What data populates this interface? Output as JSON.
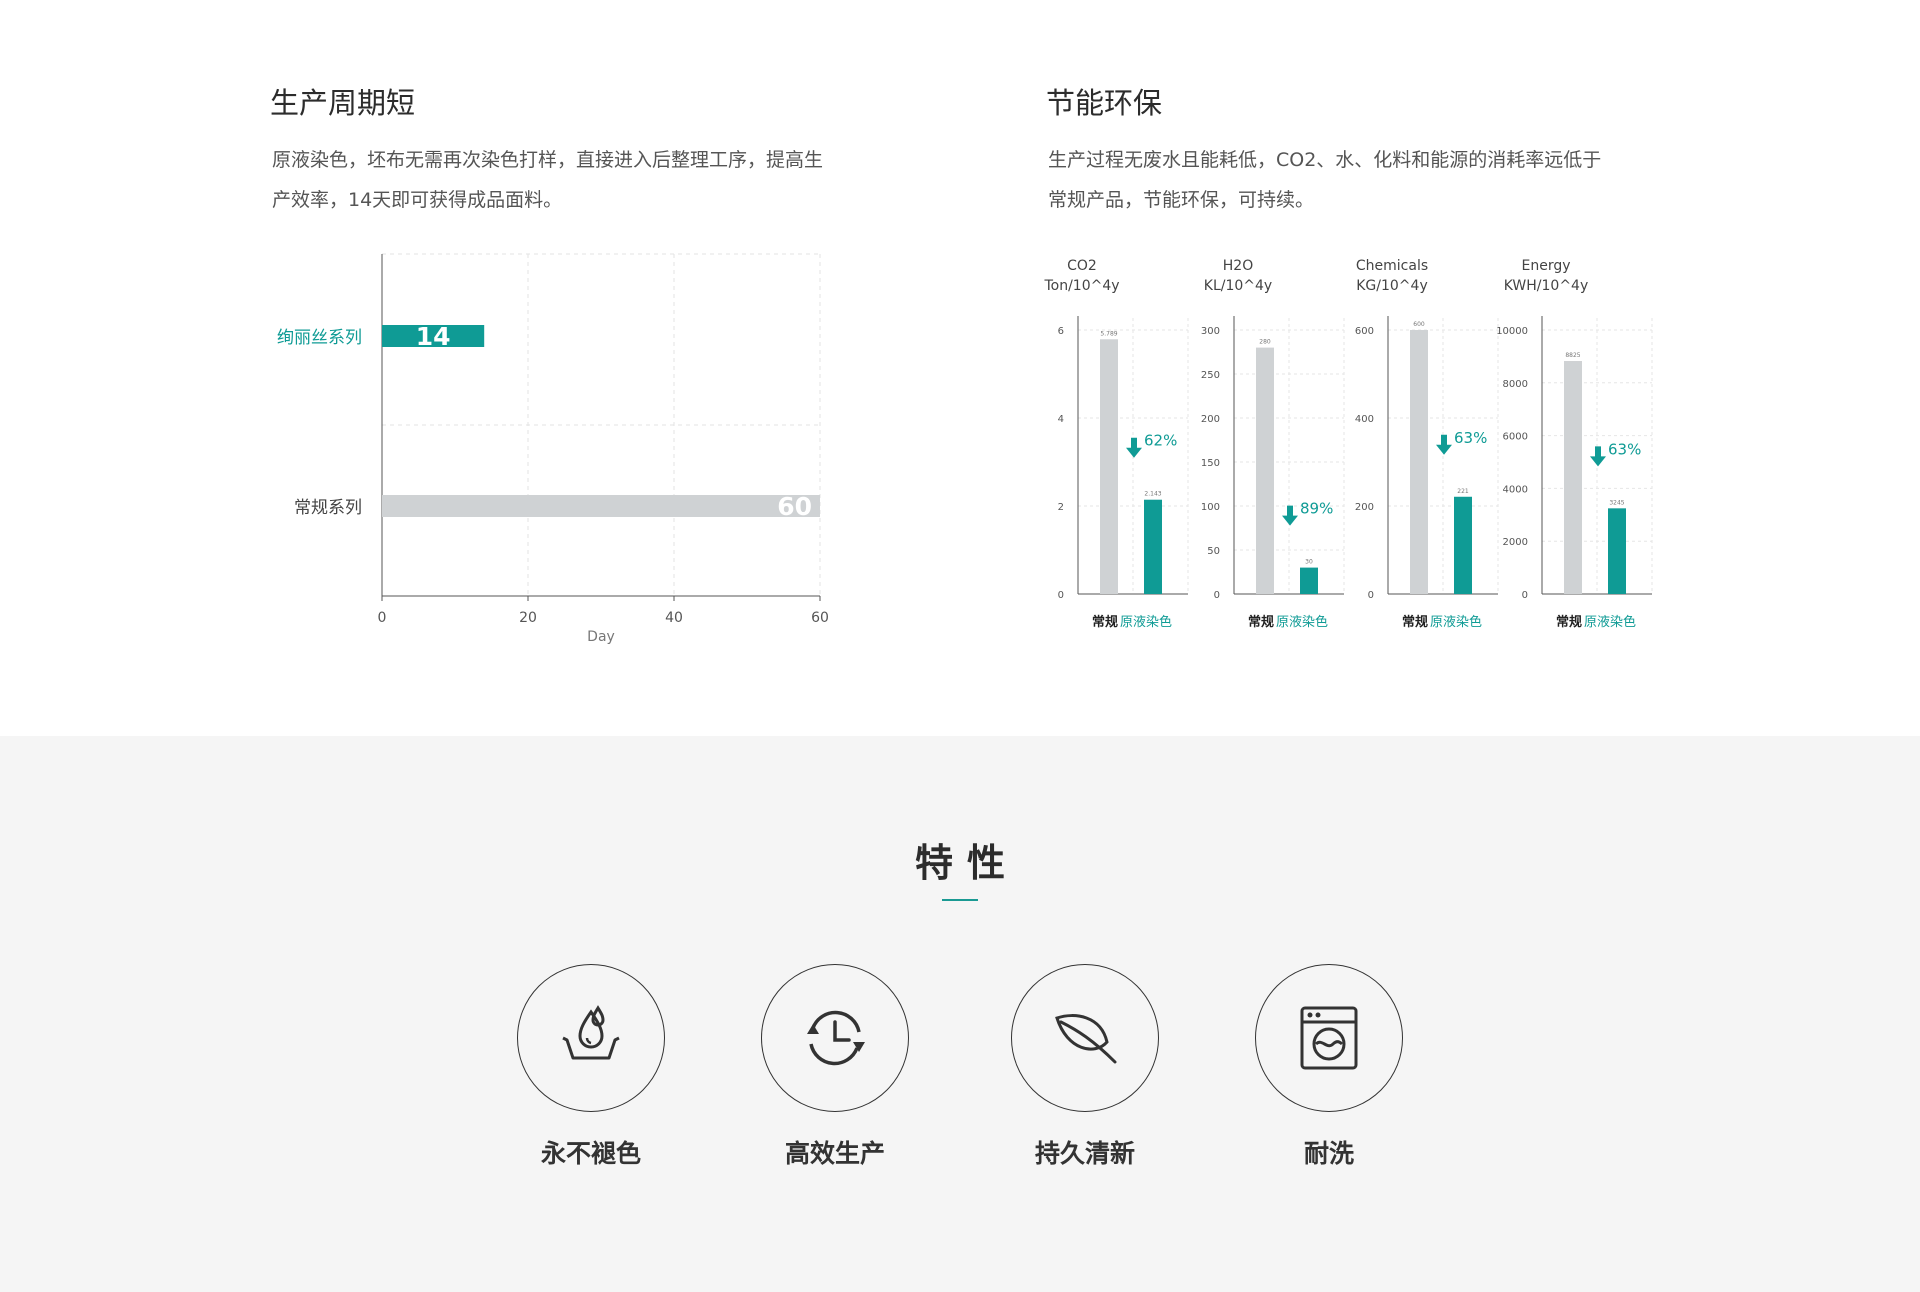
{
  "left": {
    "title": "生产周期短",
    "desc_line1": "原液染色，坯布无需再次染色打样，直接进入后整理工序，提高生",
    "desc_line2": "产效率，14天即可获得成品面料。"
  },
  "right": {
    "title": "节能环保",
    "desc_line1": "生产过程无废水且能耗低，CO2、水、化料和能源的消耗率远低于",
    "desc_line2": "常规产品，节能环保，可持续。"
  },
  "chart_data": [
    {
      "type": "bar",
      "orientation": "horizontal",
      "categories": [
        "绚丽丝系列",
        "常规系列"
      ],
      "values": [
        14,
        60
      ],
      "xlabel": "Day",
      "xlim": [
        0,
        60
      ],
      "xticks": [
        0,
        20,
        40,
        60
      ],
      "grid": true,
      "colors": [
        "#0f9b95",
        "#cfd2d4"
      ]
    },
    {
      "type": "bar",
      "title_line1": "CO2",
      "title_line2": "Ton/10^4y",
      "categories": [
        "常规",
        "原液染色"
      ],
      "values": [
        5.789,
        2.143
      ],
      "value_labels": [
        "5.789",
        "2.143"
      ],
      "ylim": [
        0,
        6
      ],
      "yticks": [
        0,
        2,
        4,
        6
      ],
      "reduction": "62%"
    },
    {
      "type": "bar",
      "title_line1": "H2O",
      "title_line2": "KL/10^4y",
      "categories": [
        "常规",
        "原液染色"
      ],
      "values": [
        280,
        30
      ],
      "value_labels": [
        "280",
        "30"
      ],
      "ylim": [
        0,
        300
      ],
      "yticks": [
        0,
        50,
        100,
        150,
        200,
        250,
        300
      ],
      "reduction": "89%"
    },
    {
      "type": "bar",
      "title_line1": "Chemicals",
      "title_line2": "KG/10^4y",
      "categories": [
        "常规",
        "原液染色"
      ],
      "values": [
        600,
        221
      ],
      "value_labels": [
        "600",
        "221"
      ],
      "ylim": [
        0,
        600
      ],
      "yticks": [
        0,
        200,
        400,
        600
      ],
      "reduction": "63%"
    },
    {
      "type": "bar",
      "title_line1": "Energy",
      "title_line2": "KWH/10^4y",
      "categories": [
        "常规",
        "原液染色"
      ],
      "values": [
        8825,
        3245
      ],
      "value_labels": [
        "8825",
        "3245"
      ],
      "ylim": [
        0,
        10000
      ],
      "yticks": [
        0,
        2000,
        4000,
        6000,
        8000,
        10000
      ],
      "reduction": "63%"
    }
  ],
  "colors": {
    "accent": "#0f9b95",
    "gray_bar": "#cfd2d4",
    "text_dark": "#2c2c2c"
  },
  "features": {
    "title": "特性",
    "items": [
      {
        "label": "永不褪色",
        "icon": "water-drop-basin-icon"
      },
      {
        "label": "高效生产",
        "icon": "clock-refresh-icon"
      },
      {
        "label": "持久清新",
        "icon": "leaf-icon"
      },
      {
        "label": "耐洗",
        "icon": "washing-machine-icon"
      }
    ]
  }
}
